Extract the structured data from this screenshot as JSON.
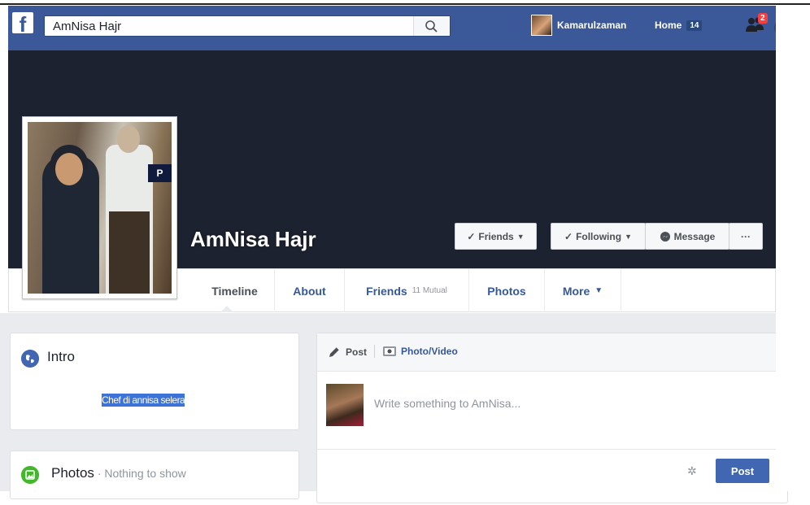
{
  "search": {
    "value": "AmNisa Hajr"
  },
  "nav": {
    "user_name": "Kamarulzaman",
    "home_label": "Home",
    "home_count": "14",
    "friend_requests_count": "2"
  },
  "profile": {
    "name": "AmNisa Hajr"
  },
  "actions": {
    "friends_label": "Friends",
    "following_label": "Following",
    "message_label": "Message",
    "more_label": "···"
  },
  "tabs": [
    {
      "label": "Timeline"
    },
    {
      "label": "About"
    },
    {
      "label": "Friends",
      "sub": "11 Mutual"
    },
    {
      "label": "Photos"
    },
    {
      "label": "More"
    }
  ],
  "intro": {
    "title": "Intro",
    "bio": "Chef di annisa selera"
  },
  "photos": {
    "title": "Photos",
    "subtitle": " · Nothing to show"
  },
  "composer": {
    "post_tab": "Post",
    "photo_tab": "Photo/Video",
    "placeholder": "Write something to AmNisa...",
    "submit": "Post"
  },
  "colors": {
    "brand": "#3b5998",
    "cover": "#1d2230",
    "accent": "#4267b2"
  }
}
